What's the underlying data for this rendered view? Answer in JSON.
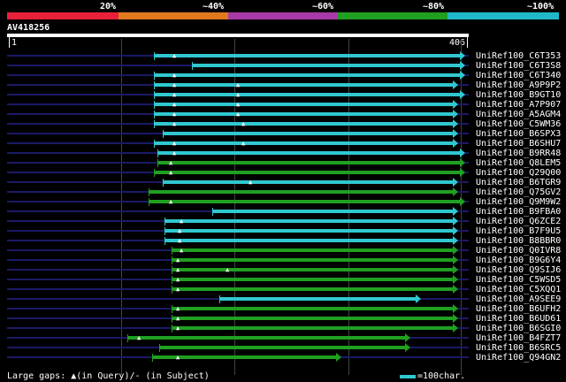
{
  "percent_labels": [
    "20%",
    "~40%",
    "~60%",
    "~80%",
    "~100%"
  ],
  "band_colors": [
    "#e8203a",
    "#e0781c",
    "#a83aa8",
    "#20a020",
    "#20b8c8"
  ],
  "colors": {
    "cyan": "#30c8d0",
    "green": "#20a020",
    "background_line": "#1a1a66"
  },
  "query_id": "AV418256",
  "ruler": {
    "start": "1",
    "end": "406"
  },
  "hits": [
    {
      "name": "UniRef100_C6T353",
      "color": "cyan"
    },
    {
      "name": "UniRef100_C6T3S8",
      "color": "cyan"
    },
    {
      "name": "UniRef100_C6T340",
      "color": "cyan"
    },
    {
      "name": "UniRef100_A9P9P2",
      "color": "cyan"
    },
    {
      "name": "UniRef100_B9GT10",
      "color": "cyan"
    },
    {
      "name": "UniRef100_A7P907",
      "color": "cyan"
    },
    {
      "name": "UniRef100_A5AGM4",
      "color": "cyan"
    },
    {
      "name": "UniRef100_C5WM36",
      "color": "cyan"
    },
    {
      "name": "UniRef100_B6SPX3",
      "color": "cyan"
    },
    {
      "name": "UniRef100_B6SHU7",
      "color": "cyan"
    },
    {
      "name": "UniRef100_B9RR48",
      "color": "cyan"
    },
    {
      "name": "UniRef100_Q8LEM5",
      "color": "green"
    },
    {
      "name": "UniRef100_Q29Q00",
      "color": "green"
    },
    {
      "name": "UniRef100_B6TGR9",
      "color": "cyan"
    },
    {
      "name": "UniRef100_Q75GV2",
      "color": "green"
    },
    {
      "name": "UniRef100_Q9M9W2",
      "color": "green"
    },
    {
      "name": "UniRef100_B9FBA0",
      "color": "cyan"
    },
    {
      "name": "UniRef100_Q6ZCE2",
      "color": "cyan"
    },
    {
      "name": "UniRef100_B7F9U5",
      "color": "cyan"
    },
    {
      "name": "UniRef100_B8BBR0",
      "color": "cyan"
    },
    {
      "name": "UniRef100_Q0IVR8",
      "color": "green"
    },
    {
      "name": "UniRef100_B9G6Y4",
      "color": "green"
    },
    {
      "name": "UniRef100_Q9SIJ6",
      "color": "green"
    },
    {
      "name": "UniRef100_C5WSD5",
      "color": "green"
    },
    {
      "name": "UniRef100_C5XQQ1",
      "color": "green"
    },
    {
      "name": "UniRef100_A9SEE9",
      "color": "cyan"
    },
    {
      "name": "UniRef100_B6UFH2",
      "color": "green"
    },
    {
      "name": "UniRef100_B6UD61",
      "color": "green"
    },
    {
      "name": "UniRef100_B6SGI0",
      "color": "green"
    },
    {
      "name": "UniRef100_B4FZT7",
      "color": "green"
    },
    {
      "name": "UniRef100_B6SRC5",
      "color": "green"
    },
    {
      "name": "UniRef100_Q94GN2",
      "color": "green"
    }
  ],
  "legend": {
    "text": "Large gaps: ▲(in Query)/- (in Subject)",
    "scale": "=100char."
  }
}
